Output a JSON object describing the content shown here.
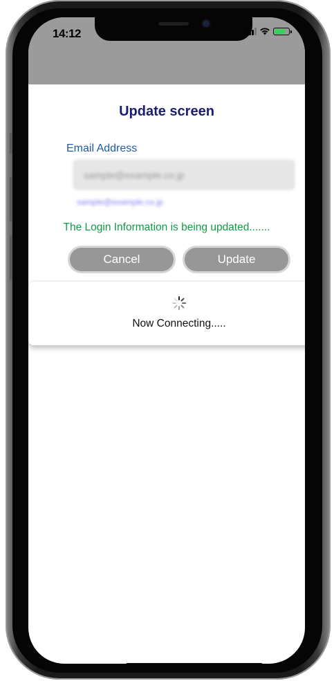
{
  "status_bar": {
    "time": "14:12",
    "battery_level": 0.85,
    "battery_color": "#3ad15a",
    "signal_bars": 3,
    "icons": [
      "signal-icon",
      "wifi-icon",
      "battery-icon"
    ]
  },
  "screen": {
    "title": "Update screen",
    "email_label": "Email Address",
    "email_value": "sample@example.co.jp",
    "email_hint": "sample@example.co.jp",
    "status_message": "The Login Information is being updated.......",
    "buttons": {
      "cancel": "Cancel",
      "update": "Update"
    }
  },
  "loader": {
    "icon": "spinner-icon",
    "message": "Now Connecting....."
  },
  "colors": {
    "header_gray": "#9b9b9b",
    "title": "#1c1d6e",
    "label_blue": "#1f5aa6",
    "success_green": "#119a46",
    "button_gray": "#979797"
  }
}
